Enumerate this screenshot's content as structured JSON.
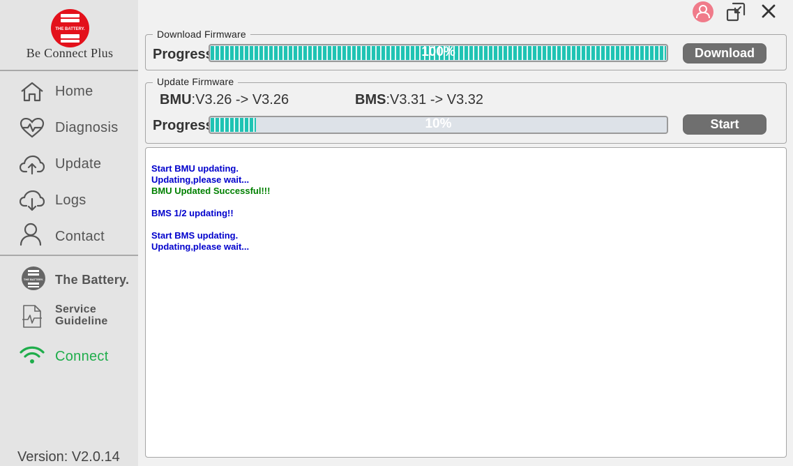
{
  "app": {
    "logo_text": "THE BATTERY.",
    "name": "Be Connect Plus",
    "version": "Version: V2.0.14"
  },
  "nav": [
    {
      "label": "Home",
      "icon": "home-icon"
    },
    {
      "label": "Diagnosis",
      "icon": "heart-pulse-icon"
    },
    {
      "label": "Update",
      "icon": "cloud-upload-icon"
    },
    {
      "label": "Logs",
      "icon": "cloud-download-icon"
    },
    {
      "label": "Contact",
      "icon": "user-icon"
    }
  ],
  "links": {
    "battery": "The Battery.",
    "battery_logo_text": "THE BATTERY.",
    "service_line1": "Service",
    "service_line2": "Guideline",
    "connect": "Connect"
  },
  "colors": {
    "sidebar_bg": "#e4e4e4",
    "brand_red": "#e3111b",
    "progress_fill": "#1fc3b3",
    "connect_green": "#1fad4b",
    "log_blue": "#0000cc",
    "log_green": "#008000",
    "button_bg": "#6f6f6f"
  },
  "download": {
    "title": "Download Firmware",
    "progress_label": "Progress",
    "progress_text": "100%",
    "progress_value": 1.0,
    "button": "Download"
  },
  "update": {
    "title": "Update Firmware",
    "bmu_label": "BMU",
    "bmu_version": ":V3.26 -> V3.26",
    "bms_label": "BMS",
    "bms_version": ":V3.31 -> V3.32",
    "progress_label": "Progress",
    "progress_text": "10%",
    "progress_value": 0.1,
    "button": "Start"
  },
  "log": [
    {
      "text": "Start BMU updating.",
      "color": "#0000cc"
    },
    {
      "text": "Updating,please wait...",
      "color": "#0000cc"
    },
    {
      "text": "BMU Updated Successful!!!",
      "color": "#008000"
    },
    {
      "text": "",
      "color": "#0000cc"
    },
    {
      "text": "BMS 1/2 updating!!",
      "color": "#0000cc"
    },
    {
      "text": "",
      "color": "#0000cc"
    },
    {
      "text": "Start BMS updating.",
      "color": "#0000cc"
    },
    {
      "text": "Updating,please wait...",
      "color": "#0000cc"
    }
  ]
}
